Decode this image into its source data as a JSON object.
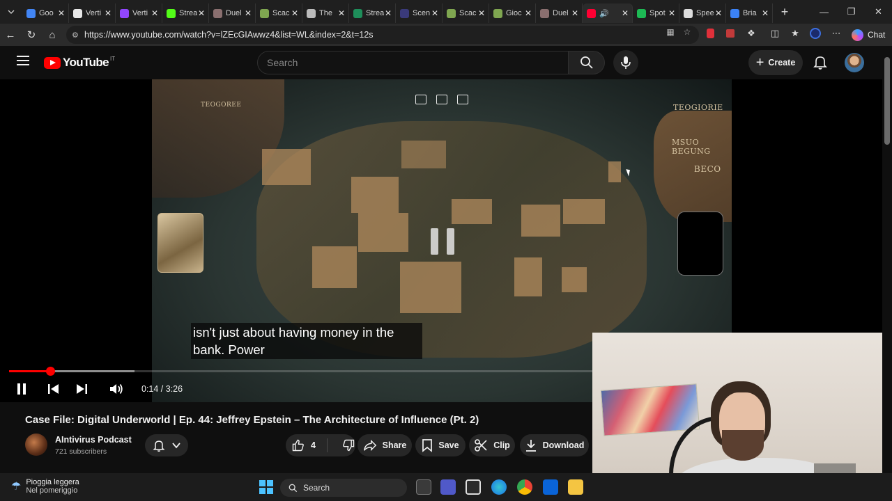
{
  "browser": {
    "tabs": [
      {
        "label": "Goo",
        "color": "#4285f4"
      },
      {
        "label": "Verti",
        "color": "#e8e8e8"
      },
      {
        "label": "Verti",
        "color": "#9146ff"
      },
      {
        "label": "Strea",
        "color": "#53fc18"
      },
      {
        "label": "Duel",
        "color": "#8a6f6f"
      },
      {
        "label": "Scac",
        "color": "#7fa650"
      },
      {
        "label": "The",
        "color": "#bbbbbb"
      },
      {
        "label": "Strea",
        "color": "#1e8e5a"
      },
      {
        "label": "Scen",
        "color": "#3a3a7a"
      },
      {
        "label": "Scac",
        "color": "#7fa650"
      },
      {
        "label": "Gioc",
        "color": "#7fa650"
      },
      {
        "label": "Duel",
        "color": "#8a6f6f"
      },
      {
        "label": "",
        "color": "#ff0033"
      },
      {
        "label": "Spot",
        "color": "#1db954"
      },
      {
        "label": "Spee",
        "color": "#dddddd"
      },
      {
        "label": "Bria",
        "color": "#3b82f6"
      }
    ],
    "url": "https://www.youtube.com/watch?v=lZEcGIAwwz4&list=WL&index=2&t=12s",
    "chat_label": "Chat"
  },
  "youtube": {
    "logo_text": "YouTube",
    "country_code": "IT",
    "search_placeholder": "Search",
    "create_label": "Create"
  },
  "video": {
    "caption_line1": "isn't just about having money in the",
    "caption_line2": "bank. Power",
    "map_labels": {
      "nw": "TEOGOREE",
      "ne_top": "TEOGIORIE",
      "ne_mid": "MSUO\nBEGUNG",
      "ne_low": "BECO"
    },
    "current_time": "0:14",
    "duration": "3:26",
    "time_display": "0:14 / 3:26",
    "progress_fraction": 0.07,
    "buffered_fraction": 0.215
  },
  "details": {
    "title": "Case File: Digital Underworld | Ep. 44: Jeffrey Epstein – The Architecture of Influence (Pt. 2)",
    "channel_name": "AIntivirus Podcast",
    "subscribers": "721 subscribers",
    "like_count": "4",
    "share_label": "Share",
    "save_label": "Save",
    "clip_label": "Clip",
    "download_label": "Download"
  },
  "taskbar": {
    "weather_condition": "Pioggia leggera",
    "weather_time": "Nel pomeriggio",
    "search_label": "Search"
  }
}
